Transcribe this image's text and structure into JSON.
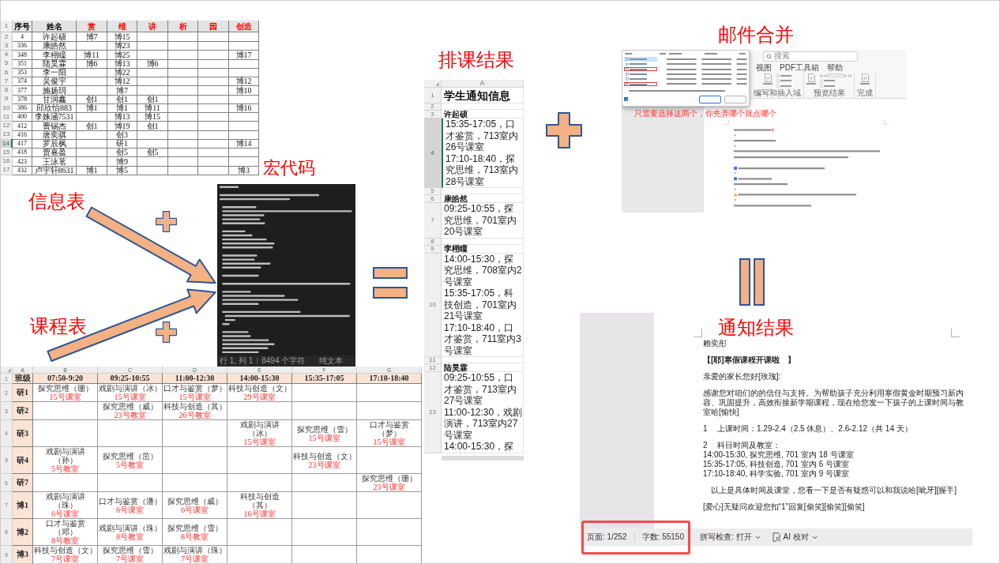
{
  "info_sheet": {
    "caption": "信息表",
    "header_row_number": "1",
    "columns": [
      {
        "label": "序号",
        "color": "#000000"
      },
      {
        "label": "姓名",
        "color": "#000000"
      },
      {
        "label": "赏",
        "color": "#ff0000"
      },
      {
        "label": "维",
        "color": "#ff0000"
      },
      {
        "label": "讲",
        "color": "#ff0000"
      },
      {
        "label": "析",
        "color": "#ff0000"
      },
      {
        "label": "园",
        "color": "#ff0000"
      },
      {
        "label": "创造",
        "color": "#ff0000"
      }
    ],
    "rows": [
      {
        "row_number": "2",
        "selected": false,
        "cells": [
          "4",
          "许起硕",
          "博7",
          "博15",
          null,
          null,
          null,
          null
        ]
      },
      {
        "row_number": "3",
        "selected": false,
        "cells": [
          "336",
          "康皓然",
          null,
          "博23",
          null,
          null,
          null,
          null
        ]
      },
      {
        "row_number": "4",
        "selected": false,
        "cells": [
          "348",
          "李栩瞳",
          "博11",
          "博25",
          null,
          null,
          null,
          "博17"
        ]
      },
      {
        "row_number": "5",
        "selected": false,
        "cells": [
          "351",
          "陆昊霖",
          "博6",
          "博13",
          "博6",
          null,
          null,
          null
        ]
      },
      {
        "row_number": "6",
        "selected": false,
        "cells": [
          "353",
          "李一阳",
          null,
          "博22",
          null,
          null,
          null,
          null
        ]
      },
      {
        "row_number": "7",
        "selected": false,
        "cells": [
          "374",
          "吴俊宇",
          null,
          "博12",
          null,
          null,
          null,
          "博12"
        ]
      },
      {
        "row_number": "8",
        "selected": false,
        "cells": [
          "377",
          "施扬玥",
          null,
          "博7",
          null,
          null,
          null,
          "博10"
        ]
      },
      {
        "row_number": "9",
        "selected": false,
        "cells": [
          "378",
          "甘润鑫",
          "创1",
          "创1",
          "创1",
          null,
          null,
          null
        ]
      },
      {
        "row_number": "10",
        "selected": false,
        "cells": [
          "386",
          "邱欣怡883",
          "博1",
          "博1",
          "博11",
          null,
          null,
          "博16"
        ]
      },
      {
        "row_number": "11",
        "selected": false,
        "cells": [
          "400",
          "李姝涵7531",
          null,
          "博13",
          "博15",
          null,
          null,
          null
        ]
      },
      {
        "row_number": "12",
        "selected": false,
        "cells": [
          "412",
          "曹锡杰",
          "创1",
          "博19",
          "创1",
          null,
          null,
          null
        ]
      },
      {
        "row_number": "13",
        "selected": false,
        "cells": [
          "416",
          "唐奕骐",
          null,
          "创3",
          null,
          null,
          null,
          null
        ]
      },
      {
        "row_number": "14",
        "selected": true,
        "cells": [
          "417",
          "罗辰枫",
          null,
          "研1",
          null,
          null,
          null,
          "博14"
        ]
      },
      {
        "row_number": "15",
        "selected": false,
        "cells": [
          "418",
          "贾嘉盈",
          null,
          "创5",
          "创5",
          null,
          null,
          null
        ]
      },
      {
        "row_number": "16",
        "selected": false,
        "cells": [
          "423",
          "王泳茗",
          null,
          "博9",
          null,
          null,
          null,
          null
        ]
      },
      {
        "row_number": "17",
        "selected": false,
        "cells": [
          "432",
          "卢宇轩8631",
          "博1",
          "博5",
          null,
          null,
          null,
          "博3"
        ]
      }
    ]
  },
  "macro_code": {
    "caption": "宏代码",
    "status": [
      "行 1, 列 1",
      "8494 个字符",
      "纯文本"
    ]
  },
  "schedule_sheet": {
    "caption": "课程表",
    "column_letters": [
      "A",
      "B",
      "C",
      "D",
      "E",
      "F",
      "G"
    ],
    "header": {
      "row_number": "1",
      "cells": [
        "班级",
        "07:50-9:20",
        "09:25-10:55",
        "11:00-12:30",
        "14:00-15:30",
        "15:35-17:05",
        "17:10-18:40"
      ]
    },
    "rows": [
      {
        "row_number": "2",
        "class": "研1",
        "cells": [
          {
            "course": [
              "探究思维（珊）"
            ],
            "room": "15号课室"
          },
          {
            "course": [
              "戏剧与演讲（冰）"
            ],
            "room": "15号课室"
          },
          {
            "course": [
              "口才与鉴赏（梦）"
            ],
            "room": "15号课室"
          },
          {
            "course": [
              "科技与创造（文）"
            ],
            "room": "29号课室"
          },
          null,
          null
        ]
      },
      {
        "row_number": "3",
        "class": "研2",
        "cells": [
          null,
          {
            "course": [
              "探究思维（威）"
            ],
            "room": "23号教室"
          },
          {
            "course": [
              "科技与创造（其）"
            ],
            "room": "26号教室"
          },
          null,
          null,
          null
        ]
      },
      {
        "row_number": "4",
        "class": "研3",
        "cells": [
          null,
          null,
          null,
          {
            "course": [
              "戏剧与演讲",
              "（冰）"
            ],
            "room": "15号课室"
          },
          {
            "course": [
              "探究思维（雪）"
            ],
            "room": "15号课室"
          },
          {
            "course": [
              "口才与鉴赏",
              "（梦）"
            ],
            "room": "15号课室"
          }
        ]
      },
      {
        "row_number": "5",
        "class": "研4",
        "cells": [
          {
            "course": [
              "戏剧与演讲",
              "（孙）"
            ],
            "room": "5号教室"
          },
          {
            "course": [
              "探究思维（茁）"
            ],
            "room": "5号教室"
          },
          null,
          null,
          {
            "course": [
              "科技与创造（文）"
            ],
            "room": "23号课室"
          },
          null
        ]
      },
      {
        "row_number": "6",
        "class": "研7",
        "cells": [
          null,
          null,
          null,
          null,
          null,
          {
            "course": [
              "探究思维（珊）"
            ],
            "room": "23号课室"
          }
        ]
      },
      {
        "row_number": "7",
        "class": "博1",
        "cells": [
          {
            "course": [
              "戏剧与演讲",
              "（珠）"
            ],
            "room": "6号课室"
          },
          {
            "course": [
              "口才与鉴赏（潘）"
            ],
            "room": "6号课室"
          },
          {
            "course": [
              "探究思维（威）"
            ],
            "room": "6号课室"
          },
          {
            "course": [
              "科技与创造",
              "（其）"
            ],
            "room": "16号课室"
          },
          null,
          null
        ]
      },
      {
        "row_number": "8",
        "class": "博2",
        "cells": [
          {
            "course": [
              "口才与鉴赏",
              "（邓）"
            ],
            "room": "8号教室"
          },
          {
            "course": [
              "戏剧与演讲（珠）"
            ],
            "room": "8号教室"
          },
          {
            "course": [
              "探究思维（雪）"
            ],
            "room": "8号教室"
          },
          null,
          null,
          null
        ]
      },
      {
        "row_number": "9",
        "class": "博3",
        "cells": [
          {
            "course": [
              "科技与创造（文）"
            ],
            "room": "7号课室"
          },
          {
            "course": [
              "探究思维（雪）"
            ],
            "room": "7号课室"
          },
          {
            "course": [
              "戏剧与演讲（珠）"
            ],
            "room": "7号课室"
          },
          null,
          null,
          null
        ]
      }
    ]
  },
  "result_sheet": {
    "caption": "排课结果",
    "column_letter": "A",
    "rows": [
      {
        "row_number": "1",
        "kind": "title",
        "text": "学生通知信息",
        "selected": false
      },
      {
        "row_number": "2",
        "kind": "blank",
        "selected": false
      },
      {
        "row_number": "3",
        "kind": "name",
        "text": "许起硕",
        "selected": false
      },
      {
        "row_number": "4",
        "kind": "schedule",
        "entries": [
          "15:35-17:05，口才鉴赏，713室内26号课室",
          "17:10-18:40，探究思维，713室内28号课室"
        ],
        "selected": true
      },
      {
        "row_number": "5",
        "kind": "blank",
        "selected": false
      },
      {
        "row_number": "6",
        "kind": "name",
        "text": "康皓然",
        "selected": false
      },
      {
        "row_number": "7",
        "kind": "schedule",
        "entries": [
          "09:25-10:55，探究思维，701室内20号课室"
        ],
        "selected": false
      },
      {
        "row_number": "8",
        "kind": "blank",
        "selected": false
      },
      {
        "row_number": "9",
        "kind": "name",
        "text": "李栩瞳",
        "selected": false
      },
      {
        "row_number": "10",
        "kind": "schedule",
        "entries": [
          "14:00-15:30，探究思维，708室内2号课室",
          "15:35-17:05，科技创造，701室内21号课室",
          "17:10-18:40，口才鉴赏，711室内3号课室"
        ],
        "selected": false
      },
      {
        "row_number": "11",
        "kind": "blank",
        "selected": false
      },
      {
        "row_number": "12",
        "kind": "name",
        "text": "陆昊霖",
        "selected": false
      },
      {
        "row_number": "13",
        "kind": "schedule",
        "entries": [
          "09:25-10:55，口才鉴赏，713室内27号课室",
          "11:00-12:30，戏剧演讲，713室内27号课室",
          "14:00-15:30，探"
        ],
        "selected": false
      }
    ]
  },
  "mail_merge": {
    "caption": "邮件合并",
    "dialog": {
      "rows": [
        {
          "selected": true,
          "marked": false
        },
        {
          "selected": false,
          "marked": false
        },
        {
          "selected": false,
          "marked": true
        },
        {
          "selected": false,
          "marked": false
        },
        {
          "selected": false,
          "marked": false
        },
        {
          "selected": false,
          "marked": true
        }
      ],
      "checkbox": {
        "checked": true
      }
    },
    "annotation": "只需要选择这两个，你先弄哪个就点哪个",
    "search": {
      "placeholder": "搜索"
    },
    "tabs": [
      {
        "label": "视图",
        "selected": false
      },
      {
        "label": "PDF工具箱",
        "selected": false
      },
      {
        "label": "帮助",
        "selected": false
      }
    ],
    "ribbon_groups": [
      {
        "label": "编写和插入域",
        "buttons": [
          {
            "kind": "large"
          },
          {
            "kind": "small"
          },
          {
            "kind": "small"
          },
          {
            "kind": "small"
          }
        ]
      },
      {
        "label": "预览结果",
        "buttons": [
          {
            "kind": "large"
          },
          {
            "kind": "navigator"
          },
          {
            "kind": "small"
          },
          {
            "kind": "small"
          }
        ]
      },
      {
        "label": "完成",
        "buttons": [
          {
            "kind": "large"
          }
        ]
      }
    ]
  },
  "notification_doc": {
    "caption": "通知结果",
    "paragraphs": [
      {
        "kind": "name",
        "text": "赖奕彤"
      },
      {
        "kind": "title",
        "text": "【[耶]寒假课程开课啦　】"
      },
      {
        "kind": "text",
        "text": "亲爱的家长您好[玫瑰]:"
      },
      {
        "kind": "text",
        "text": "感谢您对咱们的的信任与支持。为帮助孩子充分利用寒假黄金时期预习新内容、巩固提升，高效衔接新学期课程，现在给您发一下孩子的上课时间与教室哈[愉快]"
      },
      {
        "kind": "numbered",
        "number": "1",
        "text": "上课时间：1.29-2.4（2.5 休息）、2.6-2.12（共 14 天）"
      },
      {
        "kind": "numbered",
        "number": "2",
        "text": "科目时间及教室：",
        "lines": [
          "14:00-15:30, 探究思维, 701 室内 18 号课室",
          "15:35-17:05, 科技创造, 701 室内 6 号课室",
          "17:10-18:40, 科学实验, 701 室内 9 号课室"
        ]
      },
      {
        "kind": "indented",
        "text": "以上是具体时间及课堂，您看一下是否有疑惑可以和我说哈[呲牙][握手]"
      },
      {
        "kind": "text",
        "text": "[爱心]无疑问欢迎您扣“1”回复[偷笑][偷笑][偷笑]"
      }
    ],
    "status_bar": [
      {
        "kind": "text",
        "text": "页面: 1/252",
        "highlighted": true
      },
      {
        "kind": "text",
        "text": "字数: 55150",
        "highlighted": true
      },
      {
        "kind": "dropdown",
        "text": "拼写检查: 打开",
        "highlighted": false
      },
      {
        "kind": "tool",
        "text": "AI 校对",
        "highlighted": false
      }
    ]
  }
}
